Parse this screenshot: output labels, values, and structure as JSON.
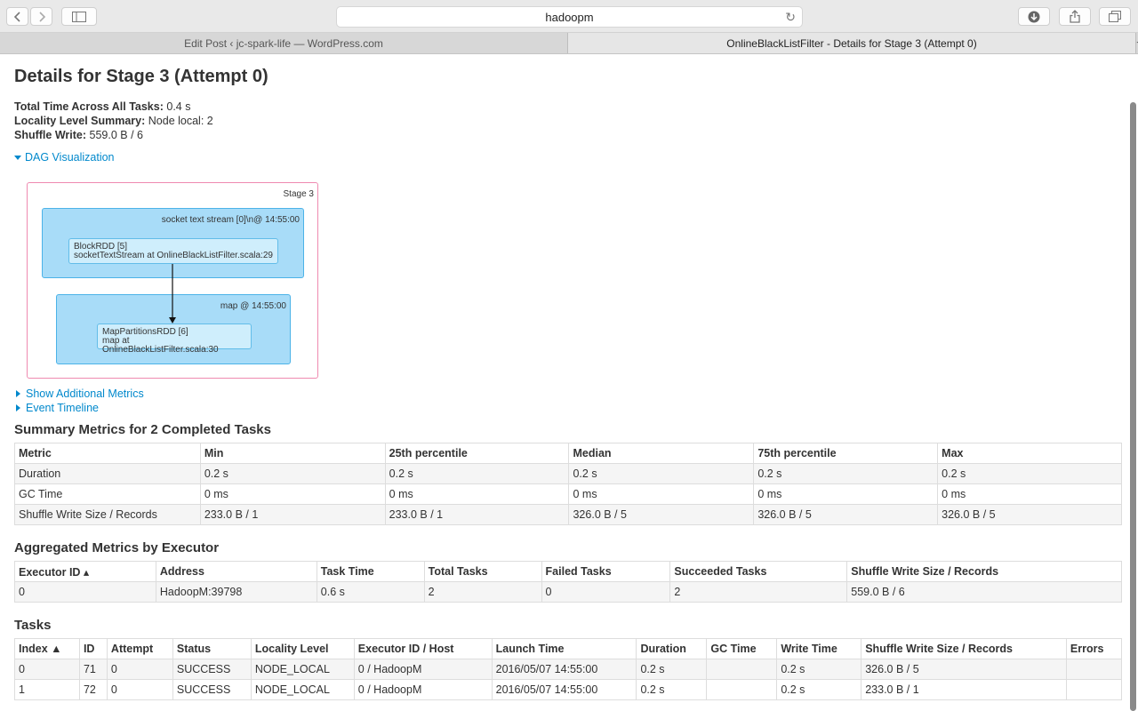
{
  "browser": {
    "url": "hadoopm",
    "tabs": [
      {
        "label": "Edit Post ‹ jc-spark-life — WordPress.com",
        "active": false
      },
      {
        "label": "OnlineBlackListFilter - Details for Stage 3 (Attempt 0)",
        "active": true
      }
    ],
    "new_tab_symbol": "+"
  },
  "page": {
    "title": "Details for Stage 3 (Attempt 0)",
    "summary": [
      {
        "label": "Total Time Across All Tasks:",
        "value": "0.4 s"
      },
      {
        "label": "Locality Level Summary:",
        "value": "Node local: 2"
      },
      {
        "label": "Shuffle Write:",
        "value": "559.0 B / 6"
      }
    ],
    "dag_toggle": "DAG Visualization",
    "dag": {
      "stage_label": "Stage 3",
      "cluster1_label": "socket text stream [0]\\n@ 14:55:00",
      "node1_line1": "BlockRDD [5]",
      "node1_line2": "socketTextStream at OnlineBlackListFilter.scala:29",
      "cluster2_label": "map @ 14:55:00",
      "node2_line1": "MapPartitionsRDD [6]",
      "node2_line2": "map at OnlineBlackListFilter.scala:30"
    },
    "additional_metrics_toggle": "Show Additional Metrics",
    "event_timeline_toggle": "Event Timeline"
  },
  "summary_metrics": {
    "heading": "Summary Metrics for 2 Completed Tasks",
    "columns": [
      "Metric",
      "Min",
      "25th percentile",
      "Median",
      "75th percentile",
      "Max"
    ],
    "rows": [
      [
        "Duration",
        "0.2 s",
        "0.2 s",
        "0.2 s",
        "0.2 s",
        "0.2 s"
      ],
      [
        "GC Time",
        "0 ms",
        "0 ms",
        "0 ms",
        "0 ms",
        "0 ms"
      ],
      [
        "Shuffle Write Size / Records",
        "233.0 B / 1",
        "233.0 B / 1",
        "326.0 B / 5",
        "326.0 B / 5",
        "326.0 B / 5"
      ]
    ]
  },
  "aggregated_metrics": {
    "heading": "Aggregated Metrics by Executor",
    "columns": [
      "Executor ID ▴",
      "Address",
      "Task Time",
      "Total Tasks",
      "Failed Tasks",
      "Succeeded Tasks",
      "Shuffle Write Size / Records"
    ],
    "rows": [
      [
        "0",
        "HadoopM:39798",
        "0.6 s",
        "2",
        "0",
        "2",
        "559.0 B / 6"
      ]
    ]
  },
  "tasks": {
    "heading": "Tasks",
    "columns": [
      "Index ▲",
      "ID",
      "Attempt",
      "Status",
      "Locality Level",
      "Executor ID / Host",
      "Launch Time",
      "Duration",
      "GC Time",
      "Write Time",
      "Shuffle Write Size / Records",
      "Errors"
    ],
    "rows": [
      [
        "0",
        "71",
        "0",
        "SUCCESS",
        "NODE_LOCAL",
        "0 / HadoopM",
        "2016/05/07 14:55:00",
        "0.2 s",
        "",
        "0.2 s",
        "326.0 B / 5",
        ""
      ],
      [
        "1",
        "72",
        "0",
        "SUCCESS",
        "NODE_LOCAL",
        "0 / HadoopM",
        "2016/05/07 14:55:00",
        "0.2 s",
        "",
        "0.2 s",
        "233.0 B / 1",
        ""
      ]
    ]
  }
}
